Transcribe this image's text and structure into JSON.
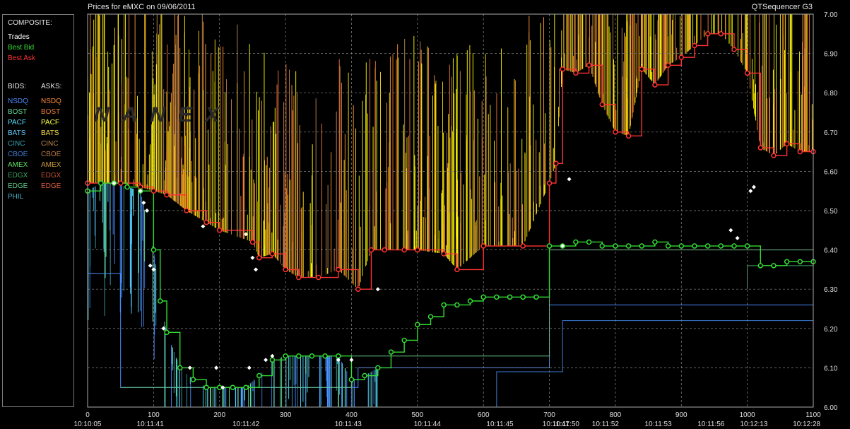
{
  "header": {
    "title": "Prices for  eMXC  on  09/06/2011",
    "app": "QTSequencer G3"
  },
  "watermark": "NANEX",
  "legend": {
    "composite_title": "COMPOSITE:",
    "composite": [
      {
        "label": "Trades",
        "color": "#ffffff"
      },
      {
        "label": "Best Bid",
        "color": "#33dd33"
      },
      {
        "label": "Best Ask",
        "color": "#ff3333"
      }
    ],
    "bids_title": "BIDS:",
    "asks_title": "ASKS:",
    "exchanges": [
      {
        "bid": "NSDQ",
        "bid_color": "#4a8cff",
        "ask": "NSDQ",
        "ask_color": "#ff8c3a"
      },
      {
        "bid": "BOST",
        "bid_color": "#66dd99",
        "ask": "BOST",
        "ask_color": "#f07a3a"
      },
      {
        "bid": "PACF",
        "bid_color": "#55e0ff",
        "ask": "PACF",
        "ask_color": "#ffff44"
      },
      {
        "bid": "BATS",
        "bid_color": "#66ccff",
        "ask": "BATS",
        "ask_color": "#ffe04a"
      },
      {
        "bid": "CINC",
        "bid_color": "#3aa0b0",
        "ask": "CINC",
        "ask_color": "#c08850"
      },
      {
        "bid": "CBOE",
        "bid_color": "#3a7ad0",
        "ask": "CBOE",
        "ask_color": "#b87840"
      },
      {
        "bid": "AMEX",
        "bid_color": "#66dd66",
        "ask": "AMEX",
        "ask_color": "#d09a40"
      },
      {
        "bid": "EDGX",
        "bid_color": "#40a060",
        "ask": "EDGX",
        "ask_color": "#c05030"
      },
      {
        "bid": "EDGE",
        "bid_color": "#66cc88",
        "ask": "EDGE",
        "ask_color": "#e06040"
      },
      {
        "bid": "PHIL",
        "bid_color": "#4ab0c8",
        "ask": "",
        "ask_color": "#000000"
      }
    ]
  },
  "chart_data": {
    "type": "line",
    "title": "Prices for  eMXC  on  09/06/2011",
    "xlabel": "",
    "ylabel": "",
    "xlim": [
      0,
      1100
    ],
    "ylim": [
      6.0,
      7.0
    ],
    "y_ticks": [
      "6.00",
      "6.10",
      "6.20",
      "6.30",
      "6.40",
      "6.50",
      "6.60",
      "6.70",
      "6.80",
      "6.90",
      "7.00"
    ],
    "x_ticks": [
      "0",
      "100",
      "200",
      "300",
      "400",
      "500",
      "600",
      "700",
      "800",
      "900",
      "1000",
      "1100"
    ],
    "x_tick_values": [
      0,
      100,
      200,
      300,
      400,
      500,
      600,
      700,
      800,
      900,
      1000,
      1100
    ],
    "time_labels": [
      {
        "x": 0,
        "label": "10:10:05"
      },
      {
        "x": 95,
        "label": "10:11:41"
      },
      {
        "x": 240,
        "label": "10:11:42"
      },
      {
        "x": 395,
        "label": "10:11:43"
      },
      {
        "x": 515,
        "label": "10:11:44"
      },
      {
        "x": 625,
        "label": "10:11:45"
      },
      {
        "x": 710,
        "label": "10:11:47"
      },
      {
        "x": 725,
        "label": "10:11:50"
      },
      {
        "x": 785,
        "label": "10:11:52"
      },
      {
        "x": 865,
        "label": "10:11:53"
      },
      {
        "x": 945,
        "label": "10:11:56"
      },
      {
        "x": 1010,
        "label": "10:12:13"
      },
      {
        "x": 1090,
        "label": "10:12:28"
      }
    ],
    "grid": true,
    "series": [
      {
        "name": "Best Ask",
        "color": "#ff3333",
        "x": [
          0,
          40,
          50,
          80,
          100,
          120,
          150,
          180,
          200,
          250,
          260,
          280,
          300,
          320,
          350,
          380,
          410,
          430,
          450,
          480,
          500,
          540,
          560,
          600,
          660,
          700,
          710,
          720,
          740,
          760,
          780,
          800,
          820,
          840,
          860,
          880,
          900,
          920,
          940,
          960,
          980,
          1000,
          1020,
          1040,
          1060,
          1080,
          1100
        ],
        "y": [
          6.57,
          6.57,
          6.57,
          6.56,
          6.55,
          6.54,
          6.5,
          6.47,
          6.45,
          6.42,
          6.38,
          6.39,
          6.35,
          6.33,
          6.33,
          6.35,
          6.3,
          6.4,
          6.4,
          6.4,
          6.4,
          6.39,
          6.35,
          6.41,
          6.41,
          6.57,
          6.62,
          6.86,
          6.85,
          6.87,
          6.77,
          6.7,
          6.69,
          6.86,
          6.82,
          6.87,
          6.89,
          6.92,
          6.95,
          6.95,
          6.91,
          6.85,
          6.66,
          6.64,
          6.67,
          6.65,
          6.65
        ]
      },
      {
        "name": "Best Bid",
        "color": "#33dd33",
        "x": [
          0,
          20,
          40,
          60,
          80,
          100,
          110,
          120,
          140,
          160,
          180,
          200,
          220,
          240,
          260,
          280,
          300,
          320,
          340,
          360,
          380,
          400,
          420,
          440,
          460,
          480,
          500,
          520,
          540,
          560,
          580,
          600,
          620,
          640,
          660,
          680,
          700,
          720,
          740,
          760,
          780,
          800,
          820,
          840,
          860,
          880,
          900,
          920,
          940,
          960,
          980,
          1000,
          1020,
          1040,
          1060,
          1080,
          1100
        ],
        "y": [
          6.55,
          6.57,
          6.57,
          6.56,
          6.55,
          6.4,
          6.27,
          6.19,
          6.1,
          6.07,
          6.05,
          6.05,
          6.05,
          6.05,
          6.08,
          6.12,
          6.13,
          6.13,
          6.13,
          6.13,
          6.13,
          6.07,
          6.08,
          6.1,
          6.14,
          6.17,
          6.21,
          6.23,
          6.26,
          6.26,
          6.27,
          6.28,
          6.28,
          6.28,
          6.28,
          6.28,
          6.41,
          6.41,
          6.42,
          6.42,
          6.41,
          6.41,
          6.41,
          6.41,
          6.42,
          6.41,
          6.41,
          6.41,
          6.41,
          6.41,
          6.41,
          6.41,
          6.36,
          6.36,
          6.37,
          6.37,
          6.37
        ]
      }
    ],
    "trades": [
      {
        "x": 40,
        "y": 6.57
      },
      {
        "x": 80,
        "y": 6.55
      },
      {
        "x": 85,
        "y": 6.52
      },
      {
        "x": 90,
        "y": 6.5
      },
      {
        "x": 95,
        "y": 6.36
      },
      {
        "x": 100,
        "y": 6.35
      },
      {
        "x": 115,
        "y": 6.2
      },
      {
        "x": 155,
        "y": 6.1
      },
      {
        "x": 175,
        "y": 6.46
      },
      {
        "x": 195,
        "y": 6.1
      },
      {
        "x": 205,
        "y": 6.05
      },
      {
        "x": 240,
        "y": 6.44
      },
      {
        "x": 250,
        "y": 6.38
      },
      {
        "x": 245,
        "y": 6.1
      },
      {
        "x": 255,
        "y": 6.35
      },
      {
        "x": 270,
        "y": 6.12
      },
      {
        "x": 280,
        "y": 6.13
      },
      {
        "x": 380,
        "y": 6.12
      },
      {
        "x": 400,
        "y": 6.12
      },
      {
        "x": 440,
        "y": 6.3
      },
      {
        "x": 720,
        "y": 6.41
      },
      {
        "x": 730,
        "y": 6.58
      },
      {
        "x": 975,
        "y": 6.45
      },
      {
        "x": 985,
        "y": 6.43
      },
      {
        "x": 1005,
        "y": 6.55
      },
      {
        "x": 1010,
        "y": 6.56
      }
    ]
  }
}
